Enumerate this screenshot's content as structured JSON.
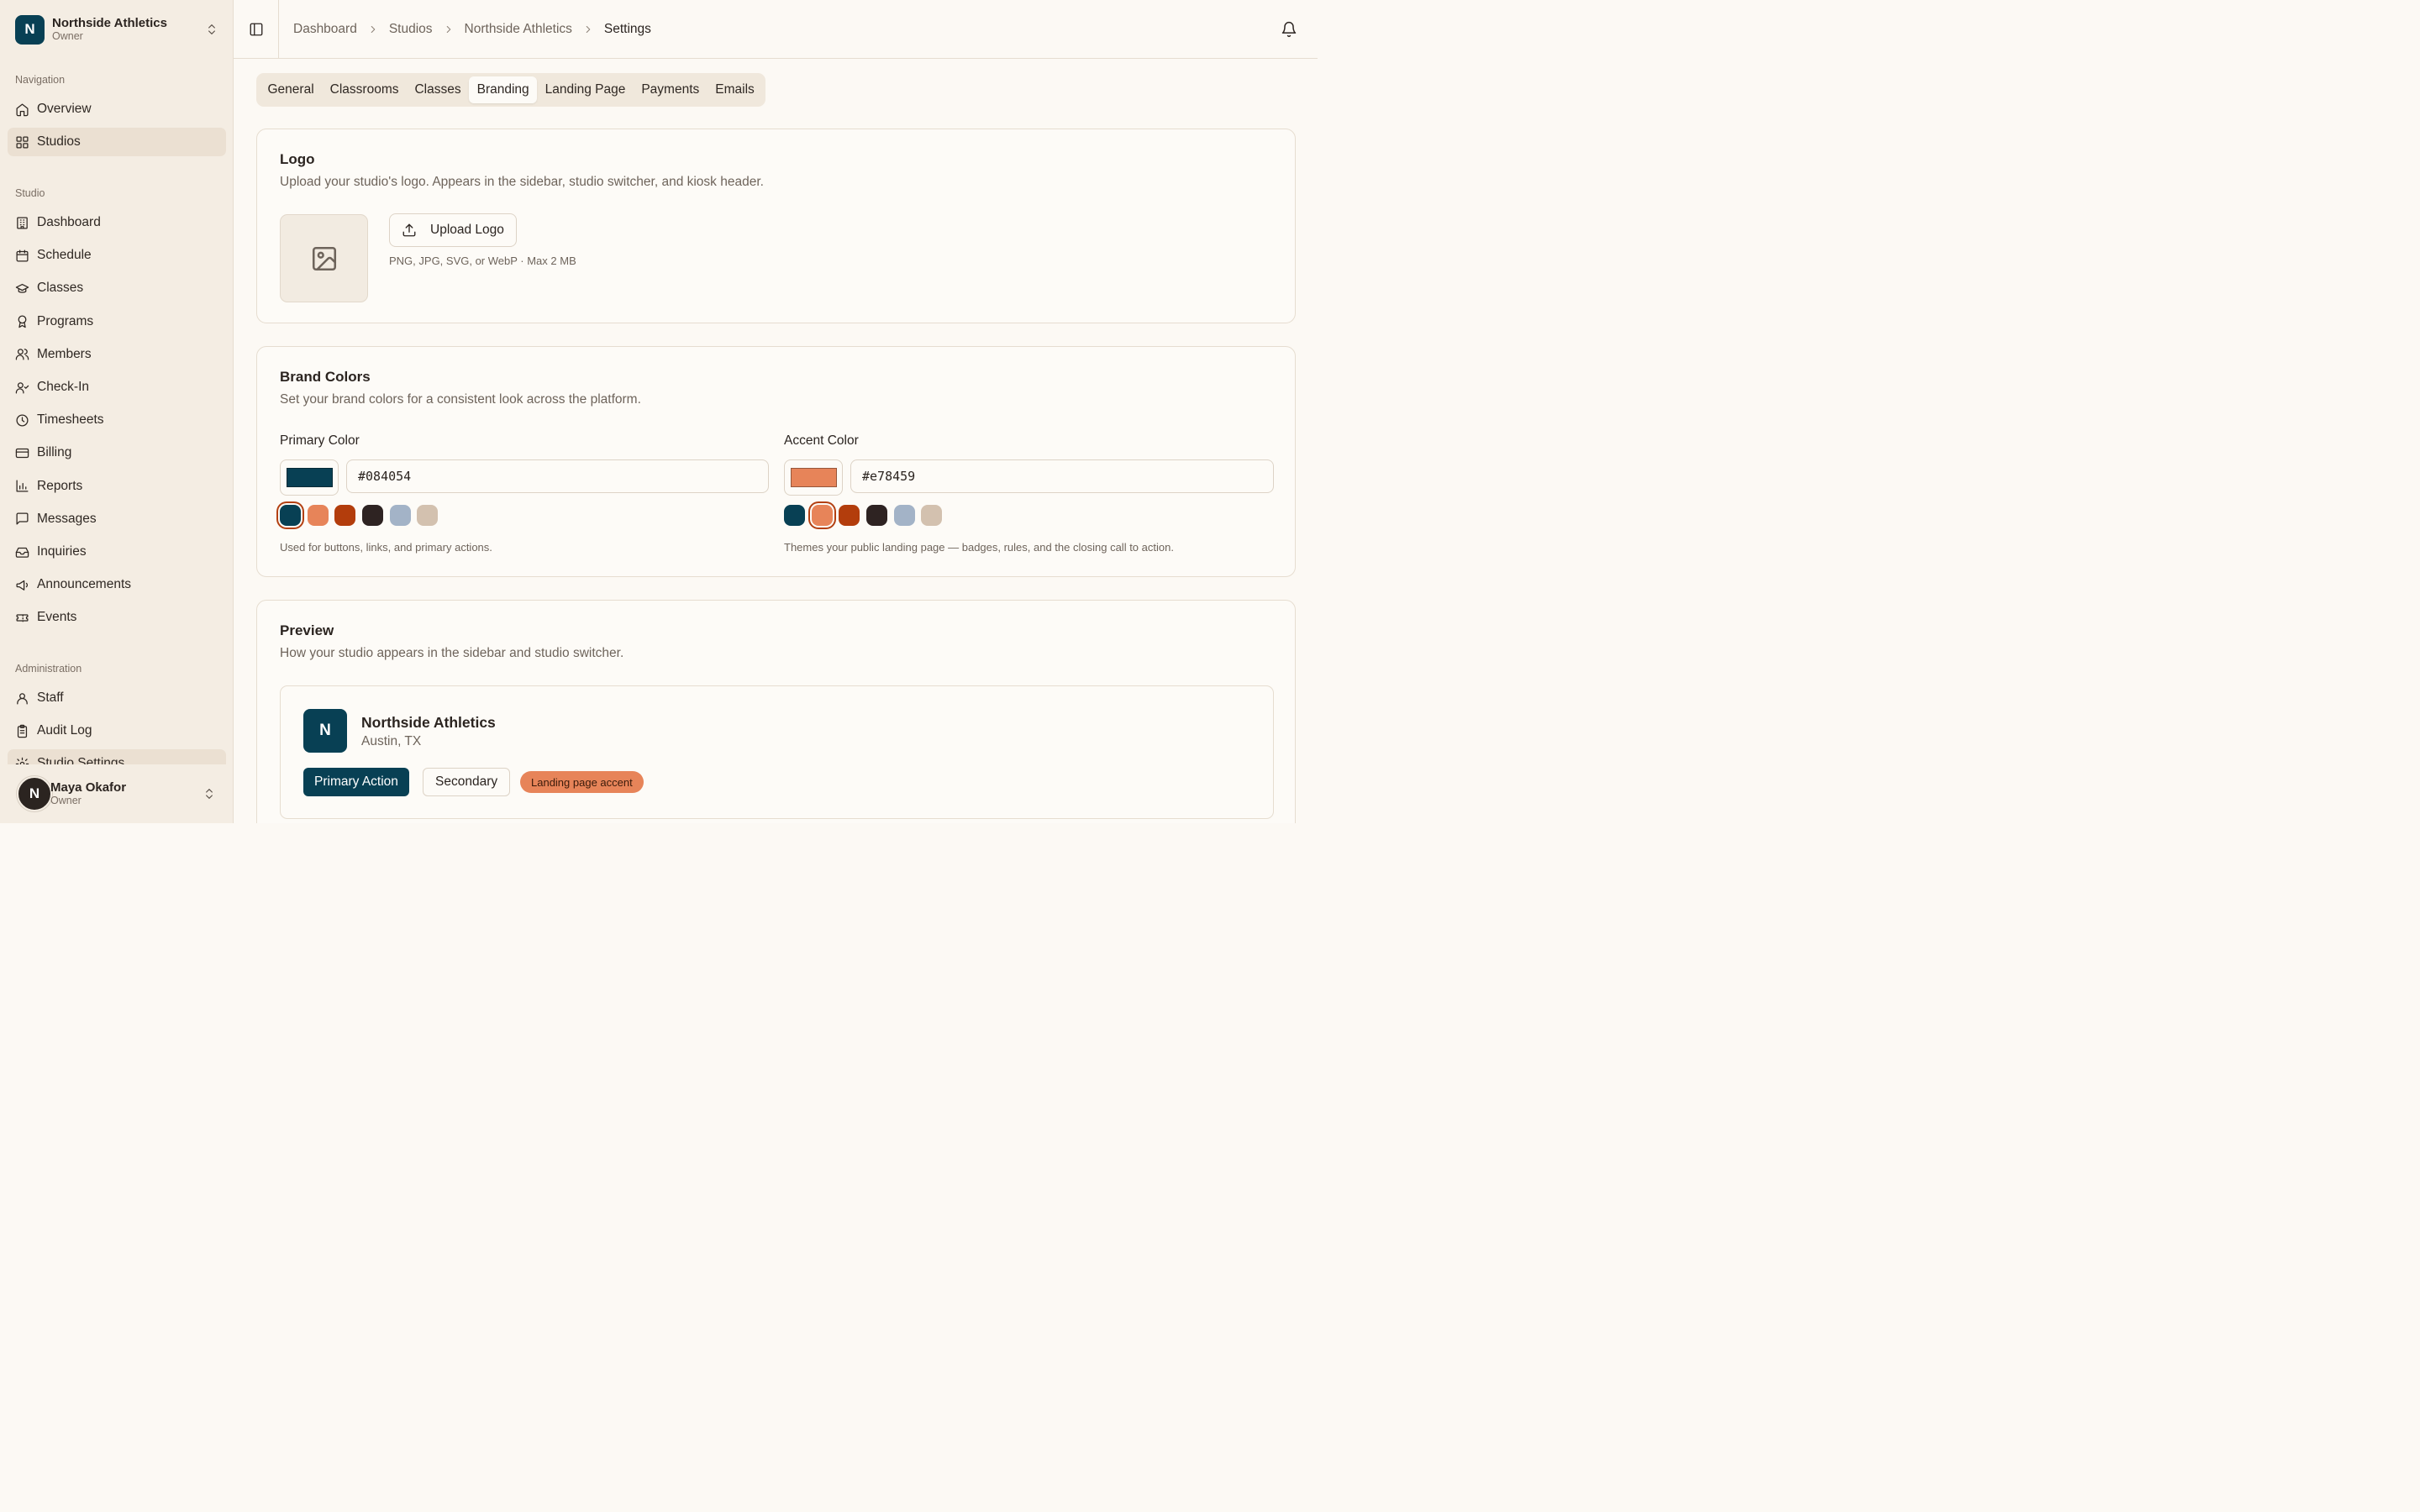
{
  "studio_switcher": {
    "initial": "N",
    "name": "Northside Athletics",
    "role": "Owner"
  },
  "nav": {
    "navigation_label": "Navigation",
    "navigation_items": [
      {
        "label": "Overview",
        "icon": "home-icon"
      },
      {
        "label": "Studios",
        "icon": "grid-icon",
        "active": true
      }
    ],
    "studio_label": "Studio",
    "studio_items": [
      {
        "label": "Dashboard",
        "icon": "building-icon"
      },
      {
        "label": "Schedule",
        "icon": "calendar-icon"
      },
      {
        "label": "Classes",
        "icon": "graduation-cap-icon"
      },
      {
        "label": "Programs",
        "icon": "award-icon"
      },
      {
        "label": "Members",
        "icon": "users-icon"
      },
      {
        "label": "Check-In",
        "icon": "user-check-icon"
      },
      {
        "label": "Timesheets",
        "icon": "clock-icon"
      },
      {
        "label": "Billing",
        "icon": "credit-card-icon"
      },
      {
        "label": "Reports",
        "icon": "bar-chart-icon"
      },
      {
        "label": "Messages",
        "icon": "message-square-icon"
      },
      {
        "label": "Inquiries",
        "icon": "inbox-icon"
      },
      {
        "label": "Announcements",
        "icon": "megaphone-icon"
      },
      {
        "label": "Events",
        "icon": "ticket-icon"
      }
    ],
    "admin_label": "Administration",
    "admin_items": [
      {
        "label": "Staff",
        "icon": "user-icon"
      },
      {
        "label": "Audit Log",
        "icon": "clipboard-list-icon"
      },
      {
        "label": "Studio Settings",
        "icon": "settings-icon"
      }
    ]
  },
  "user": {
    "initial": "N",
    "name": "Maya Okafor",
    "role": "Owner"
  },
  "breadcrumb": [
    "Dashboard",
    "Studios",
    "Northside Athletics",
    "Settings"
  ],
  "tabs": [
    {
      "label": "General"
    },
    {
      "label": "Classrooms"
    },
    {
      "label": "Classes"
    },
    {
      "label": "Branding",
      "active": true
    },
    {
      "label": "Landing Page"
    },
    {
      "label": "Payments"
    },
    {
      "label": "Emails"
    }
  ],
  "logo_card": {
    "title": "Logo",
    "description": "Upload your studio's logo. Appears in the sidebar, studio switcher, and kiosk header.",
    "upload_label": "Upload Logo",
    "hint": "PNG, JPG, SVG, or WebP · Max 2 MB"
  },
  "brand_card": {
    "title": "Brand Colors",
    "description": "Set your brand colors for a consistent look across the platform.",
    "primary": {
      "label": "Primary Color",
      "value": "#084054",
      "help": "Used for buttons, links, and primary actions.",
      "selected_index": 0
    },
    "accent": {
      "label": "Accent Color",
      "value": "#e78459",
      "help": "Themes your public landing page — badges, rules, and the closing call to action.",
      "selected_index": 1
    },
    "presets": [
      "#084054",
      "#e78459",
      "#b33d0c",
      "#2e2322",
      "#a3b3c7",
      "#d3c1af"
    ]
  },
  "preview_card": {
    "title": "Preview",
    "description": "How your studio appears in the sidebar and studio switcher.",
    "initial": "N",
    "name": "Northside Athletics",
    "location": "Austin, TX",
    "primary_action": "Primary Action",
    "secondary_action": "Secondary",
    "accent_badge": "Landing page accent"
  }
}
